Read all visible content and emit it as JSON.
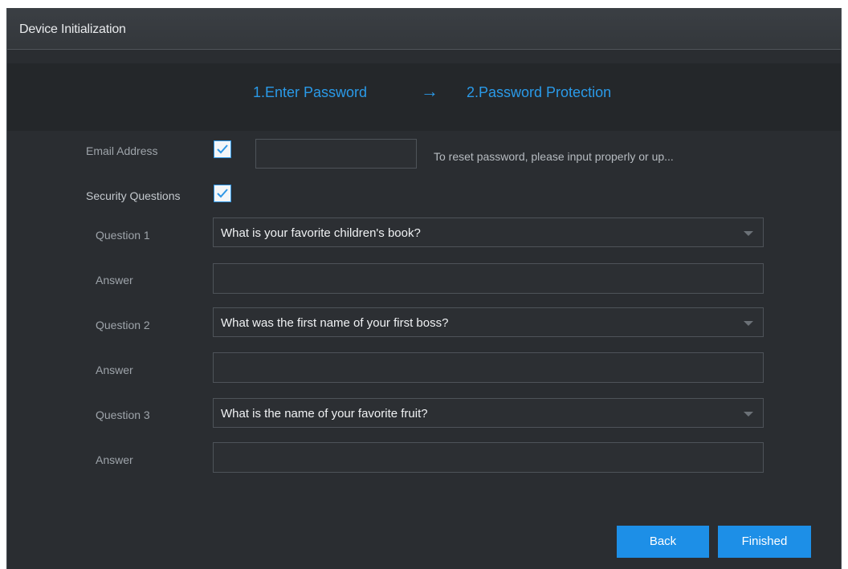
{
  "window": {
    "title": "Device Initialization"
  },
  "steps": {
    "step1": "1.Enter Password",
    "arrow": "→",
    "step2": "2.Password Protection"
  },
  "email": {
    "label": "Email Address",
    "checked": true,
    "value": "",
    "hint": "To reset password, please input properly or up..."
  },
  "security": {
    "label": "Security Questions",
    "checked": true
  },
  "questions": [
    {
      "label": "Question 1",
      "value": "What is your favorite children's book?",
      "answer_label": "Answer",
      "answer": ""
    },
    {
      "label": "Question 2",
      "value": "What was the first name of your first boss?",
      "answer_label": "Answer",
      "answer": ""
    },
    {
      "label": "Question 3",
      "value": "What is the name of your favorite fruit?",
      "answer_label": "Answer",
      "answer": ""
    }
  ],
  "buttons": {
    "back": "Back",
    "finished": "Finished"
  },
  "colors": {
    "accent": "#1d8fe7",
    "step_text": "#2a9ae8",
    "background": "#2a2d31"
  }
}
